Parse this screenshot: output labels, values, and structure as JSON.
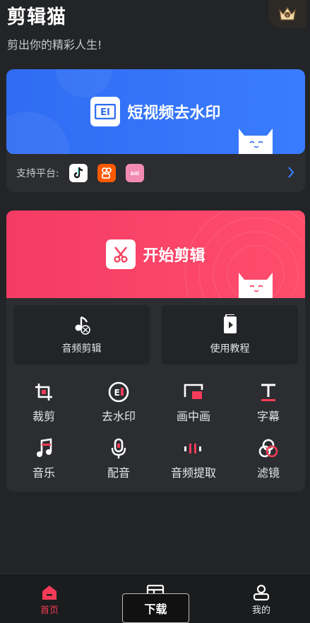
{
  "header": {
    "title": "剪辑猫",
    "subtitle": "剪出你的精彩人生!",
    "vip_icon": "crown-icon"
  },
  "watermark_card": {
    "label": "短视频去水印",
    "logo_icon": "watermark-logo-icon",
    "platforms_label": "支持平台:",
    "platforms": [
      "douyin-icon",
      "kuaishou-icon",
      "bilibili-icon"
    ],
    "chevron_icon": "chevron-right-icon"
  },
  "edit_card": {
    "label": "开始剪辑",
    "icon": "scissors-icon"
  },
  "big_tiles": [
    {
      "label": "音频剪辑",
      "icon": "audio-cut-icon"
    },
    {
      "label": "使用教程",
      "icon": "tutorial-icon"
    }
  ],
  "tools": [
    {
      "label": "裁剪",
      "icon": "crop-icon"
    },
    {
      "label": "去水印",
      "icon": "watermark-icon"
    },
    {
      "label": "画中画",
      "icon": "picture-in-picture-icon"
    },
    {
      "label": "字幕",
      "icon": "subtitle-icon"
    },
    {
      "label": "音乐",
      "icon": "music-icon"
    },
    {
      "label": "配音",
      "icon": "microphone-icon"
    },
    {
      "label": "音频提取",
      "icon": "audio-extract-icon"
    },
    {
      "label": "滤镜",
      "icon": "filter-icon"
    }
  ],
  "tabs": [
    {
      "label": "首页",
      "icon": "home-icon",
      "active": true
    },
    {
      "label": "",
      "icon": "template-icon",
      "active": false
    },
    {
      "label": "我的",
      "icon": "profile-icon",
      "active": false
    }
  ],
  "toast": {
    "label": "下载"
  },
  "colors": {
    "background": "#222427",
    "card": "#2b2d31",
    "watermark_banner": "#3174f5",
    "edit_banner": "#f8405f",
    "accent_red": "#f53b57",
    "accent_blue": "#3a7cff"
  }
}
